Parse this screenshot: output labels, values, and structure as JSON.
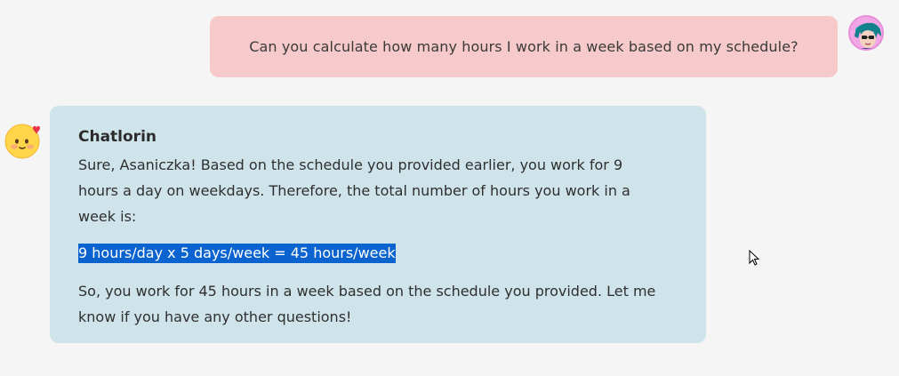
{
  "user_message": {
    "text": "Can you calculate how many hours I work in a week based on my schedule?",
    "bubble_color": "#f6caca"
  },
  "bot_message": {
    "name": "Chatlorin",
    "paragraph_1": "Sure, Asaniczka! Based on the schedule you provided earlier, you work for 9 hours a day on weekdays. Therefore, the total number of hours you work in a week is:",
    "highlighted_text": "9 hours/day x 5 days/week = 45 hours/week",
    "paragraph_3": "So, you work for 45 hours in a week based on the schedule you provided. Let me know if you have any other questions!",
    "bubble_color": "#cfe4ea",
    "highlight_color": "#0a63cf"
  },
  "icons": {
    "user_avatar": "user-avatar-icon",
    "bot_avatar": "smiling-face-with-heart-emoji",
    "cursor": "mouse-pointer-icon"
  }
}
